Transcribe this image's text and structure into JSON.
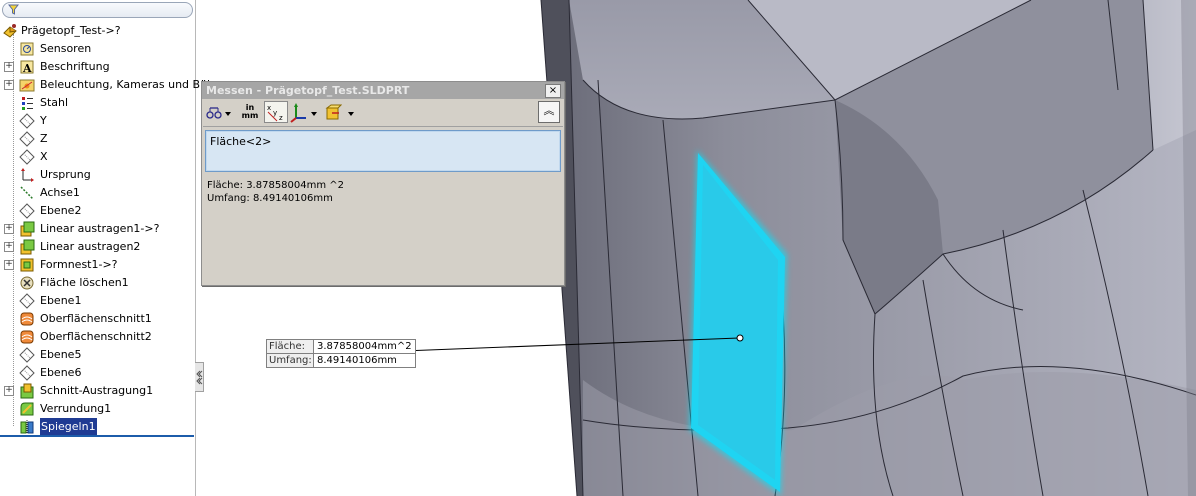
{
  "feature_tree": {
    "items": [
      {
        "label": "Prägetopf_Test->?",
        "icon": "part-icon",
        "expander": false,
        "top": true
      },
      {
        "label": "Sensoren",
        "icon": "sensor-icon",
        "expander": false
      },
      {
        "label": "Beschriftung",
        "icon": "annotation-icon",
        "expander": true
      },
      {
        "label": "Beleuchtung, Kameras und Bühne",
        "icon": "lights-cameras-icon",
        "expander": true
      },
      {
        "label": "Stahl",
        "icon": "material-icon",
        "expander": false
      },
      {
        "label": "Y",
        "icon": "plane-icon",
        "expander": false
      },
      {
        "label": "Z",
        "icon": "plane-icon",
        "expander": false
      },
      {
        "label": "X",
        "icon": "plane-icon",
        "expander": false
      },
      {
        "label": "Ursprung",
        "icon": "origin-icon",
        "expander": false
      },
      {
        "label": "Achse1",
        "icon": "axis-icon",
        "expander": false
      },
      {
        "label": "Ebene2",
        "icon": "plane-icon",
        "expander": false
      },
      {
        "label": "Linear austragen1->?",
        "icon": "extrude-icon",
        "expander": true
      },
      {
        "label": "Linear austragen2",
        "icon": "extrude-icon",
        "expander": true
      },
      {
        "label": "Formnest1->?",
        "icon": "cavity-icon",
        "expander": true
      },
      {
        "label": "Fläche löschen1",
        "icon": "delete-face-icon",
        "expander": false
      },
      {
        "label": "Ebene1",
        "icon": "plane-icon",
        "expander": false
      },
      {
        "label": "Oberflächenschnitt1",
        "icon": "surface-cut-icon",
        "expander": false
      },
      {
        "label": "Oberflächenschnitt2",
        "icon": "surface-cut-icon",
        "expander": false
      },
      {
        "label": "Ebene5",
        "icon": "plane-icon",
        "expander": false
      },
      {
        "label": "Ebene6",
        "icon": "plane-icon",
        "expander": false
      },
      {
        "label": "Schnitt-Austragung1",
        "icon": "cut-extrude-icon",
        "expander": true
      },
      {
        "label": "Verrundung1",
        "icon": "fillet-icon",
        "expander": false
      },
      {
        "label": "Spiegeln1",
        "icon": "mirror-icon",
        "expander": false,
        "selected": true
      }
    ]
  },
  "measure_dialog": {
    "title": "Messen - Prägetopf_Test.SLDPRT",
    "close_glyph": "×",
    "collapse_glyph": "︽",
    "units_top": "in",
    "units_bottom": "mm",
    "selection": "Fläche<2>",
    "results": {
      "area": "Fläche:  3.87858004mm ^2",
      "perimeter": "Umfang: 8.49140106mm"
    }
  },
  "callout": {
    "area_label": "Fläche:",
    "area_value": "3.87858004mm^2",
    "perimeter_label": "Umfang:",
    "perimeter_value": "8.49140106mm"
  },
  "colors": {
    "highlight_face": "#00e5ff",
    "model_face_light": "#a8aab8",
    "model_face_dark": "#5b5c68",
    "selection_bg": "#1f3b93"
  }
}
